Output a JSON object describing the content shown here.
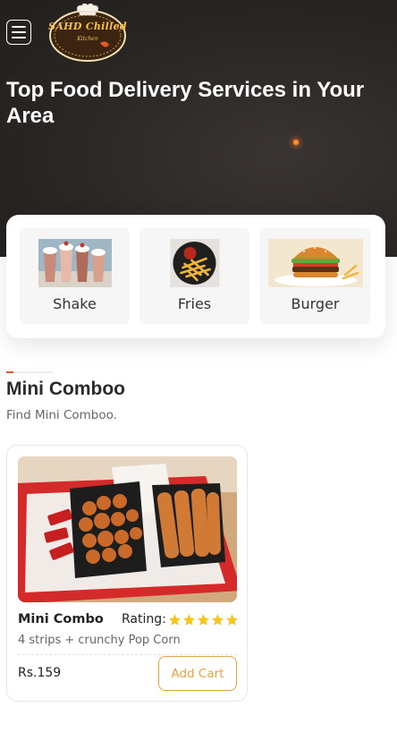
{
  "header": {
    "menu_icon": "hamburger-menu-icon",
    "logo": {
      "name": "SAHD Chilled",
      "sub": "Kitchen"
    },
    "title": "Top Food Delivery Services in Your Area"
  },
  "categories": [
    {
      "label": "Shake",
      "icon": "shake-image"
    },
    {
      "label": "Fries",
      "icon": "fries-image"
    },
    {
      "label": "Burger",
      "icon": "burger-image"
    }
  ],
  "section": {
    "title": "Mini Comboo",
    "subtitle": "Find Mini Comboo."
  },
  "product": {
    "name": "Mini Combo",
    "rating_label": "Rating:",
    "rating": 5,
    "description": "4 strips + crunchy Pop Corn",
    "price": "Rs.159",
    "add_cart_label": "Add Cart"
  },
  "colors": {
    "hero_bg": "#2a2624",
    "accent": "#e9a23b",
    "accent_line": "#e4572e",
    "star": "#f5c518"
  }
}
